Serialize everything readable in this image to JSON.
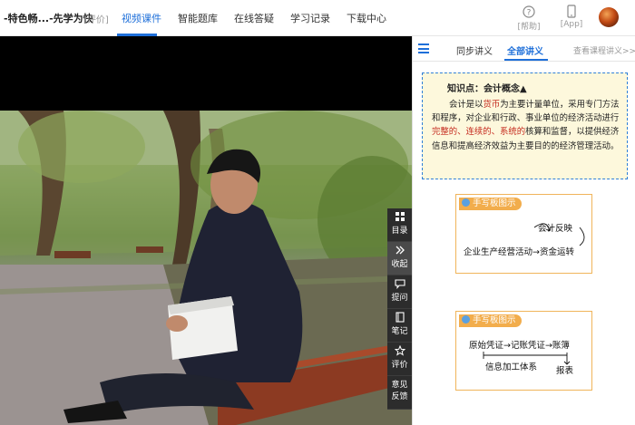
{
  "topbar": {
    "course_title": "-特色畅...-先学为快",
    "eval_link": "[评价]",
    "tabs": [
      {
        "label": "视频课件",
        "active": true
      },
      {
        "label": "智能题库",
        "active": false
      },
      {
        "label": "在线答疑",
        "active": false
      },
      {
        "label": "学习记录",
        "active": false
      },
      {
        "label": "下载中心",
        "active": false
      }
    ],
    "help_label": "[帮助]",
    "app_label": "[App]",
    "accent_color": "#1e6fd9"
  },
  "video_tools": [
    {
      "icon": "grid-icon",
      "label": "目录"
    },
    {
      "icon": "double-chevron-right-icon",
      "label": "收起"
    },
    {
      "icon": "chat-bubble-icon",
      "label": "提问"
    },
    {
      "icon": "notebook-icon",
      "label": "笔记"
    },
    {
      "icon": "star-icon",
      "label": "评价"
    },
    {
      "icon": "feedback-icon",
      "label_line1": "意见",
      "label_line2": "反馈"
    }
  ],
  "panel": {
    "tabs": [
      {
        "label": "同步讲义",
        "active": false
      },
      {
        "label": "全部讲义",
        "active": true
      }
    ],
    "view_all_link": "查看课程讲义>>",
    "knowledge": {
      "title": "知识点：会计概念▲",
      "p1": "会计是以",
      "p2": "货币",
      "p3": "为主要计量单位，采用专门方法和程序，对企业和行政、事业单位的经济活动进行",
      "p4": "完整的、连续的、系统的",
      "p5": "核算和监督，以提供经济信息和提高经济效益为主要目的的经济管理活动。"
    },
    "handwriting_1": {
      "header": "手写板图示",
      "line_top": "会计反映",
      "line_main": "企业生产经营活动→资金运转"
    },
    "handwriting_2": {
      "header": "手写板图示",
      "line_main": "原始凭证→记账凭证→账簿",
      "line_sub": "信息加工体系",
      "line_right": "报表"
    }
  }
}
